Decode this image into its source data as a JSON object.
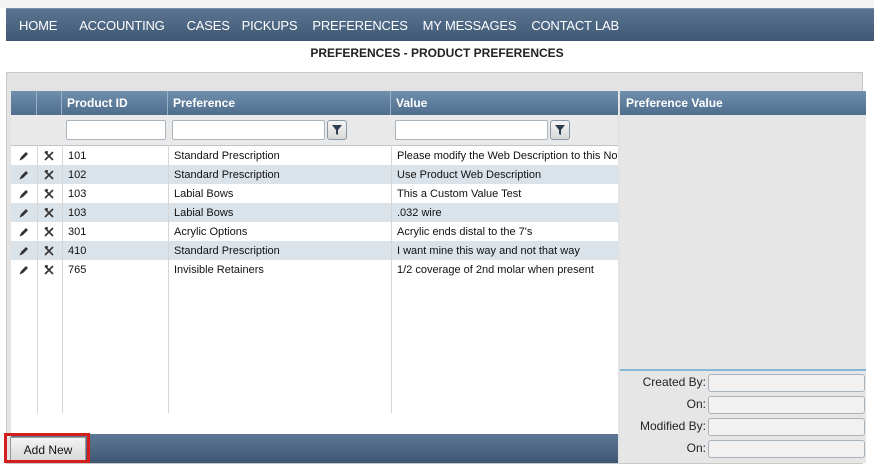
{
  "nav": {
    "items": [
      "HOME",
      "ACCOUNTING",
      "CASES",
      "PICKUPS",
      "PREFERENCES",
      "MY MESSAGES",
      "CONTACT LAB"
    ]
  },
  "page_title": "PREFERENCES - PRODUCT PREFERENCES",
  "grid": {
    "columns": [
      "Product ID",
      "Preference",
      "Value"
    ],
    "rows": [
      {
        "product_id": "101",
        "preference": "Standard Prescription",
        "value": "Please modify the Web Description to this Nov"
      },
      {
        "product_id": "102",
        "preference": "Standard Prescription",
        "value": "Use Product Web Description"
      },
      {
        "product_id": "103",
        "preference": "Labial Bows",
        "value": "This a Custom Value Test"
      },
      {
        "product_id": "103",
        "preference": "Labial Bows",
        "value": ".032 wire"
      },
      {
        "product_id": "301",
        "preference": "Acrylic Options",
        "value": "Acrylic ends distal to the 7's"
      },
      {
        "product_id": "410",
        "preference": "Standard Prescription",
        "value": "I want mine this way and not that way"
      },
      {
        "product_id": "765",
        "preference": "Invisible Retainers",
        "value": "1/2 coverage of 2nd molar when present"
      }
    ],
    "add_new_label": "Add New",
    "icons": {
      "edit": "pencil-icon",
      "delete": "x-delete-icon",
      "filter": "funnel-filter-icon"
    }
  },
  "side_panel": {
    "title": "Preference Value",
    "fields": [
      {
        "label": "Created By:",
        "value": ""
      },
      {
        "label": "On:",
        "value": ""
      },
      {
        "label": "Modified By:",
        "value": ""
      },
      {
        "label": "On:",
        "value": ""
      }
    ]
  },
  "colors": {
    "nav_bg": "#4a6380",
    "header_bg": "#5f7f9e",
    "alt_row": "#dbe3ea",
    "highlight_outline": "#d41f1f"
  }
}
